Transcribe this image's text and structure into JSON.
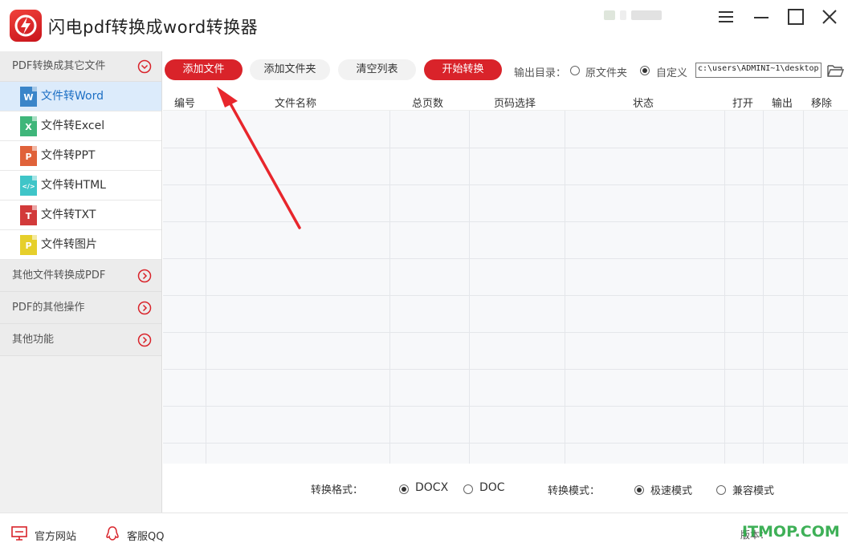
{
  "app": {
    "title": "闪电pdf转换成word转换器",
    "icons": {
      "logo": "lightning-logo",
      "menu": "menu-icon",
      "minimize": "minimize-icon",
      "maximize": "maximize-icon",
      "close": "close-icon"
    },
    "accent_color": "#d9232a"
  },
  "sidebar": {
    "categories": [
      {
        "label": "PDF转换成其它文件",
        "icon": "chevron-down-circle-icon",
        "expanded": true
      },
      {
        "label": "其他文件转换成PDF",
        "icon": "chevron-right-circle-icon",
        "expanded": false
      },
      {
        "label": "PDF的其他操作",
        "icon": "chevron-right-circle-icon",
        "expanded": false
      },
      {
        "label": "其他功能",
        "icon": "chevron-right-circle-icon",
        "expanded": false
      }
    ],
    "items": [
      {
        "label": "文件转Word",
        "badge": "W",
        "color": "#3a85c9",
        "active": true
      },
      {
        "label": "文件转Excel",
        "badge": "X",
        "color": "#3fb67a",
        "active": false
      },
      {
        "label": "文件转PPT",
        "badge": "P",
        "color": "#e0623a",
        "active": false
      },
      {
        "label": "文件转HTML",
        "badge": "</>",
        "color": "#3fc5c8",
        "active": false
      },
      {
        "label": "文件转TXT",
        "badge": "T",
        "color": "#d23a3a",
        "active": false
      },
      {
        "label": "文件转图片",
        "badge": "P",
        "color": "#e6cf2b",
        "active": false
      }
    ]
  },
  "toolbar": {
    "add_file": "添加文件",
    "add_folder": "添加文件夹",
    "clear_list": "清空列表",
    "start": "开始转换",
    "output_label": "输出目录：",
    "option_original": "原文件夹",
    "option_custom": "自定义",
    "selected_output": "自定义",
    "path": "c:\\users\\ADMINI~1\\desktop"
  },
  "table": {
    "columns": [
      "编号",
      "文件名称",
      "总页数",
      "页码选择",
      "状态",
      "打开",
      "输出",
      "移除"
    ],
    "rows": []
  },
  "options": {
    "format_label": "转换格式：",
    "format_docx": "DOCX",
    "format_doc": "DOC",
    "selected_format": "DOCX",
    "mode_label": "转换模式：",
    "mode_fast": "极速模式",
    "mode_compatible": "兼容模式",
    "selected_mode": "极速模式"
  },
  "footer": {
    "website": "官方网站",
    "qq": "客服QQ",
    "version": "版本：",
    "watermark": "ITMOP.COM"
  }
}
